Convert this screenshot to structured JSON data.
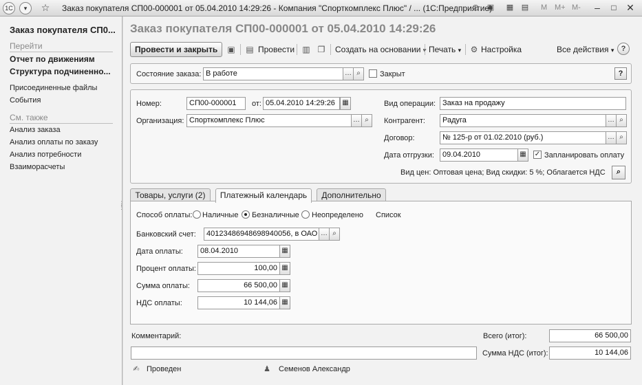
{
  "window": {
    "title": "Заказ покупателя СП00-000001 от 05.04.2010 14:29:26 - Компания \"Спорткомплекс Плюс\" / ...  (1С:Предприятие)",
    "logo": "1С",
    "mem_buttons": [
      "M",
      "M+",
      "M-"
    ],
    "icons": [
      "menu-dropdown-icon",
      "favorite-star-icon",
      "history-icon",
      "print-icon",
      "calculator-icon",
      "calendar-icon",
      "minimize-icon",
      "maximize-icon",
      "close-icon"
    ]
  },
  "sidebar": {
    "title": "Заказ покупателя СП0...",
    "goto_header": "Перейти",
    "goto_items": [
      "Отчет по движениям",
      "Структура подчиненно..."
    ],
    "other_items": [
      "Присоединенные файлы",
      "События"
    ],
    "see_also_header": "См. также",
    "see_also_items": [
      "Анализ заказа",
      "Анализ оплаты по заказу",
      "Анализ потребности",
      "Взаиморасчеты"
    ]
  },
  "main": {
    "title": "Заказ покупателя СП00-000001 от 05.04.2010 14:29:26",
    "toolbar": {
      "post_close": "Провести и закрыть",
      "post": "Провести",
      "create_based": "Создать на основании",
      "print": "Печать",
      "settings": "Настройка",
      "all_actions": "Все действия",
      "help": "?"
    },
    "state": {
      "label": "Состояние заказа:",
      "value": "В работе",
      "closed_label": "Закрыт",
      "closed_checked": false
    },
    "header": {
      "number_label": "Номер:",
      "number_value": "СП00-000001",
      "from_label": "от:",
      "date_value": "05.04.2010 14:29:26",
      "org_label": "Организация:",
      "org_value": "Спорткомплекс Плюс",
      "op_label": "Вид операции:",
      "op_value": "Заказ на продажу",
      "partner_label": "Контрагент:",
      "partner_value": "Радуга",
      "contract_label": "Договор:",
      "contract_value": "№ 125-р от 01.02.2010 (руб.)",
      "ship_label": "Дата отгрузки:",
      "ship_value": "09.04.2010",
      "plan_payment_label": "Запланировать оплату",
      "plan_payment_checked": true,
      "price_info": "Вид цен: Оптовая цена; Вид скидки: 5 %; Облагается НДС"
    },
    "tabs": [
      {
        "label": "Товары, услуги (2)",
        "active": false
      },
      {
        "label": "Платежный календарь",
        "active": true
      },
      {
        "label": "Дополнительно",
        "active": false
      }
    ],
    "payment": {
      "method_label": "Способ оплаты:",
      "options": [
        "Наличные",
        "Безналичные",
        "Неопределено"
      ],
      "selected": "Безналичные",
      "list_link": "Список",
      "bank_label": "Банковский счет:",
      "bank_value": "40123486948698940056, в ОАО '",
      "date_label": "Дата оплаты:",
      "date_value": "08.04.2010",
      "percent_label": "Процент оплаты:",
      "percent_value": "100,00",
      "sum_label": "Сумма оплаты:",
      "sum_value": "66 500,00",
      "vat_label": "НДС оплаты:",
      "vat_value": "10 144,06"
    },
    "footer": {
      "comment_label": "Комментарий:",
      "comment_value": "",
      "total_label": "Всего (итог):",
      "total_value": "66 500,00",
      "vat_total_label": "Сумма НДС (итог):",
      "vat_total_value": "10 144,06",
      "status": "Проведен",
      "author": "Семенов Александр"
    }
  }
}
